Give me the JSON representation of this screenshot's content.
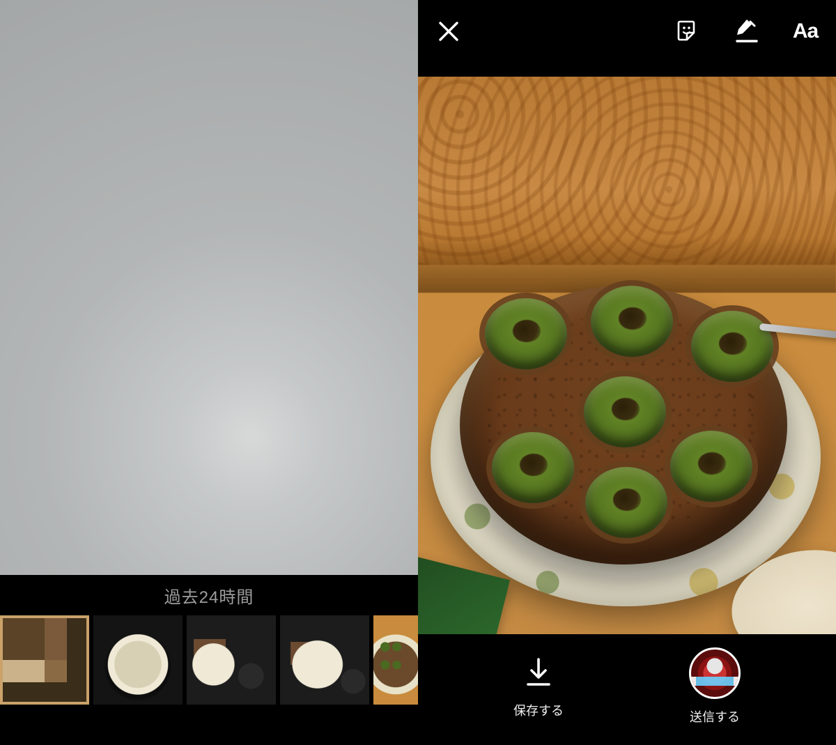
{
  "left": {
    "recent_label": "過去24時間",
    "thumbs": [
      {
        "name": "bento"
      },
      {
        "name": "bowl"
      },
      {
        "name": "set1"
      },
      {
        "name": "set2"
      },
      {
        "name": "escargot"
      }
    ]
  },
  "right": {
    "tools": {
      "sticker_icon": "sticker-icon",
      "draw_icon": "draw-icon",
      "text_label": "Aa"
    },
    "actions": {
      "save_label": "保存する",
      "send_label": "送信する"
    }
  }
}
